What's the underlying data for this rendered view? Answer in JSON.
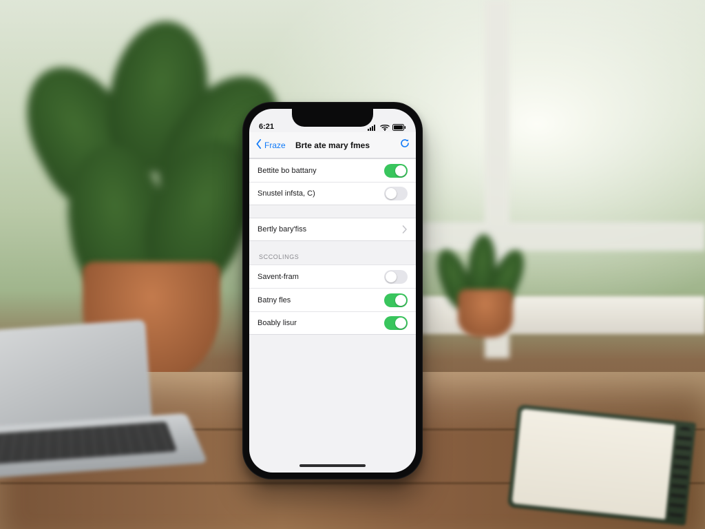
{
  "status": {
    "time": "6:21"
  },
  "nav": {
    "back_label": "Fraze",
    "title": "Brte ate mary fmes"
  },
  "groups": [
    {
      "header": "",
      "rows": [
        {
          "label": "Bettite bo battany",
          "kind": "toggle",
          "on": true
        },
        {
          "label": "Snustel infsta, C)",
          "kind": "toggle",
          "on": false
        }
      ]
    },
    {
      "header": "",
      "rows": [
        {
          "label": "Bertly bary'fiss",
          "kind": "disclosure"
        }
      ]
    },
    {
      "header": "Sccolings",
      "rows": [
        {
          "label": "Savent-fram",
          "kind": "toggle",
          "on": false
        },
        {
          "label": "Batny fles",
          "kind": "toggle",
          "on": true
        },
        {
          "label": "Boably lisur",
          "kind": "toggle",
          "on": true
        }
      ]
    }
  ]
}
